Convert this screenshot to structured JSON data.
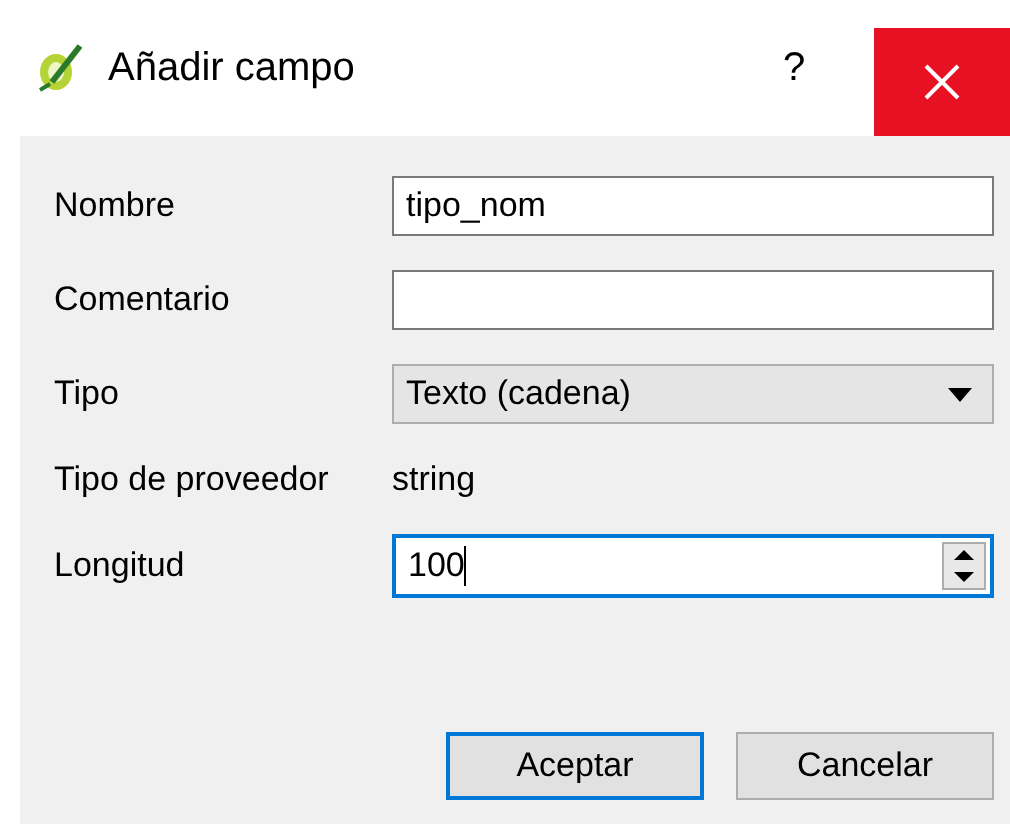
{
  "window": {
    "title": "Añadir campo",
    "help": "?"
  },
  "fields": [
    {
      "kind": "text",
      "label": "Nombre",
      "value": "tipo_nom",
      "focused": false
    },
    {
      "kind": "text",
      "label": "Comentario",
      "focused": false
    },
    {
      "kind": "combo",
      "label": "Tipo",
      "value": "Texto (cadena)",
      "focused": false
    },
    {
      "kind": "readonly",
      "label": "Tipo de proveedor",
      "value": "string"
    },
    {
      "kind": "spin",
      "label": "Longitud",
      "value": "100",
      "focused": true
    }
  ],
  "buttons": [
    {
      "label": "Aceptar",
      "default": true
    },
    {
      "label": "Cancelar",
      "default": false
    }
  ]
}
